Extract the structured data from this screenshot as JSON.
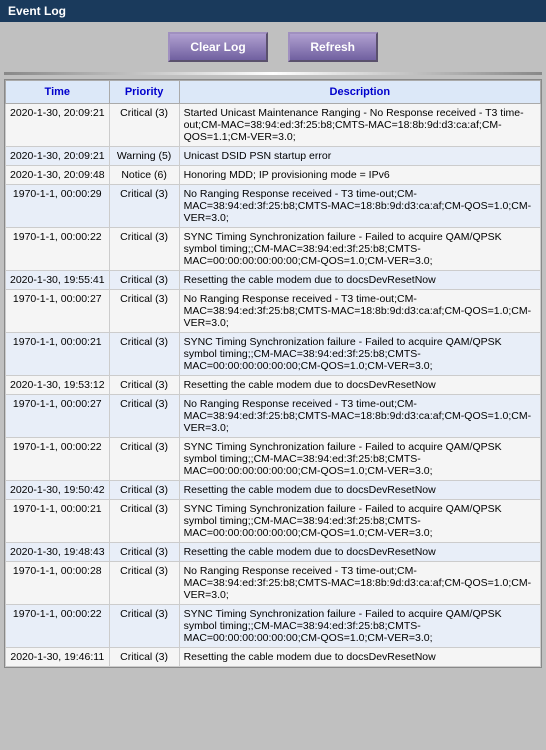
{
  "window": {
    "title": "Event Log"
  },
  "toolbar": {
    "clear_label": "Clear Log",
    "refresh_label": "Refresh"
  },
  "table": {
    "headers": [
      "Time",
      "Priority",
      "Description"
    ],
    "rows": [
      {
        "time": "2020-1-30, 20:09:21",
        "priority": "Critical (3)",
        "description": "Started Unicast Maintenance Ranging - No Response received - T3 time-out;CM-MAC=38:94:ed:3f:25:b8;CMTS-MAC=18:8b:9d:d3:ca:af;CM-QOS=1.1;CM-VER=3.0;"
      },
      {
        "time": "2020-1-30, 20:09:21",
        "priority": "Warning (5)",
        "description": "Unicast DSID PSN startup error"
      },
      {
        "time": "2020-1-30, 20:09:48",
        "priority": "Notice (6)",
        "description": "Honoring MDD; IP provisioning mode = IPv6"
      },
      {
        "time": "1970-1-1, 00:00:29",
        "priority": "Critical (3)",
        "description": "No Ranging Response received - T3 time-out;CM-MAC=38:94:ed:3f:25:b8;CMTS-MAC=18:8b:9d:d3:ca:af;CM-QOS=1.0;CM-VER=3.0;"
      },
      {
        "time": "1970-1-1, 00:00:22",
        "priority": "Critical (3)",
        "description": "SYNC Timing Synchronization failure - Failed to acquire QAM/QPSK symbol timing;;CM-MAC=38:94:ed:3f:25:b8;CMTS-MAC=00:00:00:00:00:00;CM-QOS=1.0;CM-VER=3.0;"
      },
      {
        "time": "2020-1-30, 19:55:41",
        "priority": "Critical (3)",
        "description": "Resetting the cable modem due to docsDevResetNow"
      },
      {
        "time": "1970-1-1, 00:00:27",
        "priority": "Critical (3)",
        "description": "No Ranging Response received - T3 time-out;CM-MAC=38:94:ed:3f:25:b8;CMTS-MAC=18:8b:9d:d3:ca:af;CM-QOS=1.0;CM-VER=3.0;"
      },
      {
        "time": "1970-1-1, 00:00:21",
        "priority": "Critical (3)",
        "description": "SYNC Timing Synchronization failure - Failed to acquire QAM/QPSK symbol timing;;CM-MAC=38:94:ed:3f:25:b8;CMTS-MAC=00:00:00:00:00:00;CM-QOS=1.0;CM-VER=3.0;"
      },
      {
        "time": "2020-1-30, 19:53:12",
        "priority": "Critical (3)",
        "description": "Resetting the cable modem due to docsDevResetNow"
      },
      {
        "time": "1970-1-1, 00:00:27",
        "priority": "Critical (3)",
        "description": "No Ranging Response received - T3 time-out;CM-MAC=38:94:ed:3f:25:b8;CMTS-MAC=18:8b:9d:d3:ca:af;CM-QOS=1.0;CM-VER=3.0;"
      },
      {
        "time": "1970-1-1, 00:00:22",
        "priority": "Critical (3)",
        "description": "SYNC Timing Synchronization failure - Failed to acquire QAM/QPSK symbol timing;;CM-MAC=38:94:ed:3f:25:b8;CMTS-MAC=00:00:00:00:00:00;CM-QOS=1.0;CM-VER=3.0;"
      },
      {
        "time": "2020-1-30, 19:50:42",
        "priority": "Critical (3)",
        "description": "Resetting the cable modem due to docsDevResetNow"
      },
      {
        "time": "1970-1-1, 00:00:21",
        "priority": "Critical (3)",
        "description": "SYNC Timing Synchronization failure - Failed to acquire QAM/QPSK symbol timing;;CM-MAC=38:94:ed:3f:25:b8;CMTS-MAC=00:00:00:00:00:00;CM-QOS=1.0;CM-VER=3.0;"
      },
      {
        "time": "2020-1-30, 19:48:43",
        "priority": "Critical (3)",
        "description": "Resetting the cable modem due to docsDevResetNow"
      },
      {
        "time": "1970-1-1, 00:00:28",
        "priority": "Critical (3)",
        "description": "No Ranging Response received - T3 time-out;CM-MAC=38:94:ed:3f:25:b8;CMTS-MAC=18:8b:9d:d3:ca:af;CM-QOS=1.0;CM-VER=3.0;"
      },
      {
        "time": "1970-1-1, 00:00:22",
        "priority": "Critical (3)",
        "description": "SYNC Timing Synchronization failure - Failed to acquire QAM/QPSK symbol timing;;CM-MAC=38:94:ed:3f:25:b8;CMTS-MAC=00:00:00:00:00:00;CM-QOS=1.0;CM-VER=3.0;"
      },
      {
        "time": "2020-1-30, 19:46:11",
        "priority": "Critical (3)",
        "description": "Resetting the cable modem due to docsDevResetNow"
      }
    ]
  }
}
